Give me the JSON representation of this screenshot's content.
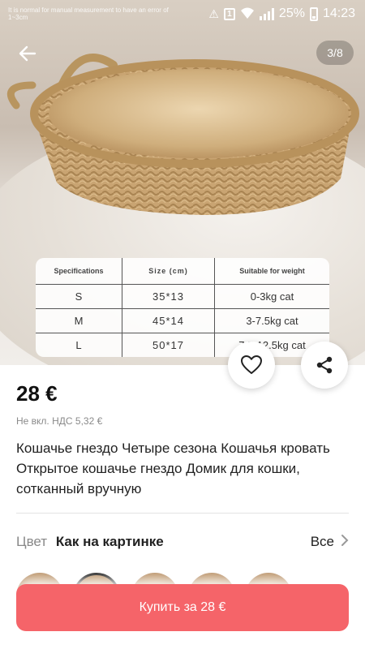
{
  "status_bar": {
    "battery": "25%",
    "time": "14:23",
    "icons": [
      "wifi-icon",
      "signal-icon",
      "battery-icon",
      "notification-icon"
    ]
  },
  "gallery": {
    "counter": "3/8",
    "measure_note": "It is normal for manual measurement to have an error of 1~3cm",
    "back_icon": "arrow-left-icon",
    "spec_table": {
      "headers": [
        "Specifications",
        "Size (cm)",
        "Suitable for weight"
      ],
      "rows": [
        [
          "S",
          "35*13",
          "0-3kg cat"
        ],
        [
          "M",
          "45*14",
          "3-7.5kg cat"
        ],
        [
          "L",
          "50*17",
          "7.5-12.5kg cat"
        ]
      ]
    }
  },
  "actions": {
    "favorite_icon": "heart-icon",
    "share_icon": "share-icon"
  },
  "product": {
    "price": "28 €",
    "vat_note": "Не вкл. НДС 5,32 €",
    "title": "Кошачье гнездо Четыре сезона Кошачья кровать Открытое кошачье гнездо Домик для кошки, сотканный вручную"
  },
  "variant": {
    "label": "Цвет",
    "value": "Как на картинке",
    "all_label": "Все",
    "swatch_count": 5
  },
  "buy_button": {
    "label": "Купить за 28 €",
    "color": "#f56469"
  }
}
